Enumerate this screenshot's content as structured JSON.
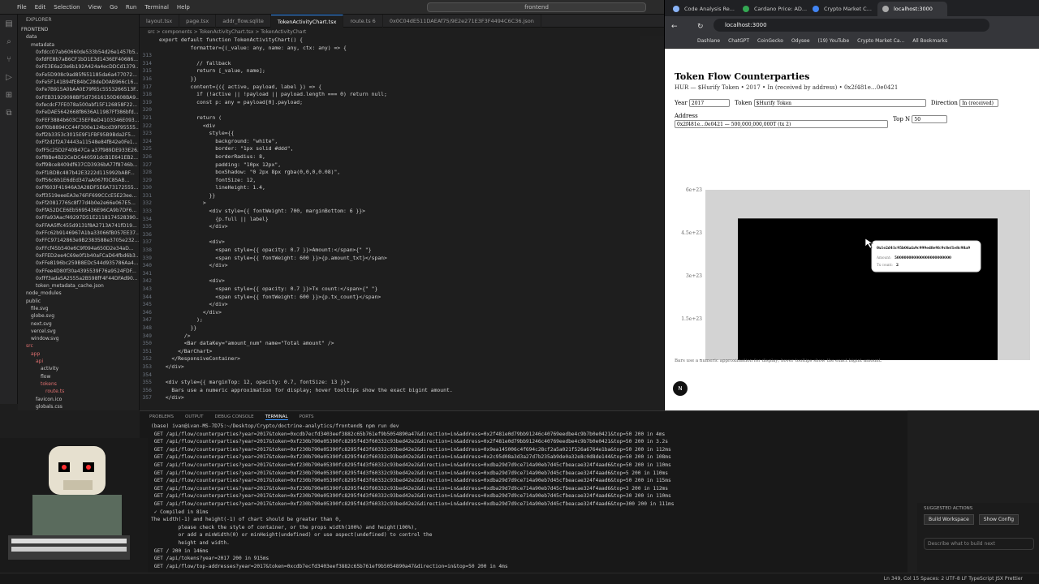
{
  "vscode": {
    "menu": [
      "File",
      "Edit",
      "Selection",
      "View",
      "Go",
      "Run",
      "Terminal",
      "Help"
    ],
    "search": "frontend",
    "explorer_title": "EXPLORER",
    "tree": [
      {
        "t": "FRONTEND",
        "i": 0
      },
      {
        "t": "data",
        "i": 1
      },
      {
        "t": "metadata",
        "i": 2
      },
      {
        "t": "0xfdcc07ab60660de533b54d26e1457b5...",
        "i": 3
      },
      {
        "t": "0xfdFE8b7aB6CF1bD1E3d1436EF40686...",
        "i": 3
      },
      {
        "t": "0xFE3E6a23e6b192A424a4ecDDCd1379...",
        "i": 3
      },
      {
        "t": "0xFe5D908c9ad85f651185da6a477072...",
        "i": 3
      },
      {
        "t": "0xFe5F141B94fE84bC28deD0AB966c16...",
        "i": 3
      },
      {
        "t": "0xFe7B915A0bAA0E79f65c5553266513F...",
        "i": 3
      },
      {
        "t": "0xFEB31929098BF5d73616150D608BA9...",
        "i": 3
      },
      {
        "t": "0xfecdcF7FE078a500abf15F126858F22...",
        "i": 3
      },
      {
        "t": "0xFeDAE5642668f8636A11987Ff386bfd...",
        "i": 3
      },
      {
        "t": "0xFEF3884b603C35EF8eD4103346E093...",
        "i": 3
      },
      {
        "t": "0xFf0b8894CC44F300e124bcd39F95555...",
        "i": 3
      },
      {
        "t": "0xff2b3353c3015E9F1FBF95B9Bda2F5...",
        "i": 3
      },
      {
        "t": "0xFf2d2f2A74443a11548e84fB42e0Fe1...",
        "i": 3
      },
      {
        "t": "0xfF5c25D2F40B47Ca a37f989DE933E26...",
        "i": 3
      },
      {
        "t": "0xff8Be4B22CeDC440591dcB1E641EB2...",
        "i": 3
      },
      {
        "t": "0xff9Bce8409df637CD3936bA77f8746b...",
        "i": 3
      },
      {
        "t": "0xFf1BDBc487b42E3222d115992bABF...",
        "i": 3
      },
      {
        "t": "0xff56c6b1E6dEd347aA067f0C85AB...",
        "i": 3
      },
      {
        "t": "0xFf603F41946A3A28DF5E6A73172555...",
        "i": 3
      },
      {
        "t": "0xff3519eeeEA3e76FiF699CCcE5E23ee...",
        "i": 3
      },
      {
        "t": "0xFf2081776Sc8f77d4b0e2e66e067E5...",
        "i": 3
      },
      {
        "t": "0xFfA52DCE6Eb5695436E96CA9b7DF6...",
        "i": 3
      },
      {
        "t": "0xFFa93Aacf49297D51E2118174528390...",
        "i": 3
      },
      {
        "t": "0xFFAA5ffc455d9131f8A2713A741fD19...",
        "i": 3
      },
      {
        "t": "0xFFc62b9146967A1ba33066fB057EE37...",
        "i": 3
      },
      {
        "t": "0xFFC97142863e9B2383588e3705e232...",
        "i": 3
      },
      {
        "t": "0xFFcf45b540e6C9f094a650D2e34aD...",
        "i": 3
      },
      {
        "t": "0xFFED2ee4C69e0f1b40aFCaD64fbd6b3...",
        "i": 3
      },
      {
        "t": "0xFFe8196bc259B8EDc544d935786Aa4...",
        "i": 3
      },
      {
        "t": "0xFFee4D80f30a4395539F76a9524FDF...",
        "i": 3
      },
      {
        "t": "0xfFf3adaSA2555a2B598fF4F44DFAd90...",
        "i": 3
      },
      {
        "t": "token_metadata_cache.json",
        "i": 3
      },
      {
        "t": "node_modules",
        "i": 1
      },
      {
        "t": "public",
        "i": 1
      },
      {
        "t": "file.svg",
        "i": 2
      },
      {
        "t": "globe.svg",
        "i": 2
      },
      {
        "t": "next.svg",
        "i": 2
      },
      {
        "t": "vercel.svg",
        "i": 2
      },
      {
        "t": "window.svg",
        "i": 2
      },
      {
        "t": "src",
        "i": 1,
        "c": "red"
      },
      {
        "t": "app",
        "i": 2,
        "c": "red"
      },
      {
        "t": "api",
        "i": 3,
        "c": "red"
      },
      {
        "t": "activity",
        "i": 4
      },
      {
        "t": "flow",
        "i": 4
      },
      {
        "t": "tokens",
        "i": 4,
        "c": "red"
      },
      {
        "t": "route.ts",
        "i": 5,
        "c": "red"
      },
      {
        "t": "favicon.ico",
        "i": 3
      },
      {
        "t": "globals.css",
        "i": 3
      },
      {
        "t": "layout.tsx",
        "i": 3
      },
      {
        "t": "page.tsx",
        "i": 3
      },
      {
        "t": "components",
        "i": 2
      }
    ],
    "tabs": [
      "layout.tsx",
      "page.tsx",
      "addr_flow.sqlite",
      "TokenActivityChart.tsx",
      "route.ts 6",
      "0x0C04dE511DAEAf75/9E2e271E3F3F4494C6C36.json"
    ],
    "active_tab": 3,
    "breadcrumb": "src > components > TokenActivityChart.tsx > TokenActivityChart",
    "code": [
      {
        "n": "",
        "c": "export default function TokenActivityChart() {"
      },
      {
        "n": "",
        "c": "          formatter={(_value: any, name: any, ctx: any) => {"
      },
      {
        "n": "313",
        "c": ""
      },
      {
        "n": "314",
        "c": "            // fallback"
      },
      {
        "n": "315",
        "c": "            return [_value, name];"
      },
      {
        "n": "316",
        "c": "          }}"
      },
      {
        "n": "317",
        "c": "          content={({ active, payload, label }) => {"
      },
      {
        "n": "318",
        "c": "            if (!active || !payload || payload.length === 0) return null;"
      },
      {
        "n": "319",
        "c": "            const p: any = payload[0].payload;"
      },
      {
        "n": "320",
        "c": ""
      },
      {
        "n": "321",
        "c": "            return ("
      },
      {
        "n": "322",
        "c": "              <div"
      },
      {
        "n": "323",
        "c": "                style={{"
      },
      {
        "n": "324",
        "c": "                  background: \"white\","
      },
      {
        "n": "325",
        "c": "                  border: \"1px solid #ddd\","
      },
      {
        "n": "326",
        "c": "                  borderRadius: 8,"
      },
      {
        "n": "327",
        "c": "                  padding: \"10px 12px\","
      },
      {
        "n": "328",
        "c": "                  boxShadow: \"0 2px 8px rgba(0,0,0,0.08)\","
      },
      {
        "n": "329",
        "c": "                  fontSize: 12,"
      },
      {
        "n": "330",
        "c": "                  lineHeight: 1.4,"
      },
      {
        "n": "331",
        "c": "                }}"
      },
      {
        "n": "332",
        "c": "              >"
      },
      {
        "n": "333",
        "c": "                <div style={{ fontWeight: 700, marginBottom: 6 }}>"
      },
      {
        "n": "334",
        "c": "                  {p.full || label}"
      },
      {
        "n": "335",
        "c": "                </div>"
      },
      {
        "n": "336",
        "c": ""
      },
      {
        "n": "337",
        "c": "                <div>"
      },
      {
        "n": "338",
        "c": "                  <span style={{ opacity: 0.7 }}>Amount:</span>{\" \"}"
      },
      {
        "n": "339",
        "c": "                  <span style={{ fontWeight: 600 }}>{p.amount_txt}</span>"
      },
      {
        "n": "340",
        "c": "                </div>"
      },
      {
        "n": "341",
        "c": ""
      },
      {
        "n": "342",
        "c": "                <div>"
      },
      {
        "n": "343",
        "c": "                  <span style={{ opacity: 0.7 }}>Tx count:</span>{\" \"}"
      },
      {
        "n": "344",
        "c": "                  <span style={{ fontWeight: 600 }}>{p.tx_count}</span>"
      },
      {
        "n": "345",
        "c": "                </div>"
      },
      {
        "n": "346",
        "c": "              </div>"
      },
      {
        "n": "347",
        "c": "            );"
      },
      {
        "n": "348",
        "c": "          }}"
      },
      {
        "n": "349",
        "c": "        />"
      },
      {
        "n": "350",
        "c": "        <Bar dataKey=\"amount_num\" name=\"Total amount\" />"
      },
      {
        "n": "351",
        "c": "      </BarChart>"
      },
      {
        "n": "352",
        "c": "    </ResponsiveContainer>"
      },
      {
        "n": "353",
        "c": "  </div>"
      },
      {
        "n": "354",
        "c": ""
      },
      {
        "n": "355",
        "c": "  <div style={{ marginTop: 12, opacity: 0.7, fontSize: 13 }}>"
      },
      {
        "n": "356",
        "c": "    Bars use a numeric approximation for display; hover tooltips show the exact bigint amount."
      },
      {
        "n": "357",
        "c": "  </div>"
      }
    ],
    "panel_tabs": [
      "PROBLEMS",
      "OUTPUT",
      "DEBUG CONSOLE",
      "TERMINAL",
      "PORTS"
    ],
    "terminal": [
      "(base) ivan@ivan-MS-7D75:~/Desktop/Crypto/doctrine-analytics/frontend$ npm run dev",
      " GET /api/flow/counterparties?year=2017&token=0xcdb7ecfd3403eef3882c65b761ef9b5054890a47&direction=in&address=0x2f481e0d79bb91246c40769eedbe4c9b7b0e0421&top=50 200 in 4ms",
      " GET /api/flow/counterparties?year=2017&token=0xf230b790e05390fc8295f4d3f60332c93bed42e2&direction=in&address=0x2f481e0d79bb91246c40769eedbe4c9b7b0e0421&top=50 200 in 3.2s",
      " GET /api/flow/counterparties?year=2017&token=0xf230b790e05390fc8295f4d3f60332c93bed42e2&direction=in&address=0x9ea145006c4f694c28cf2a5a021f526a6764e1ba&top=50 200 in 112ms",
      " GET /api/flow/counterparties?year=2017&token=0xf230b790e05390fc8295f4d3f60332c93bed42e2&direction=in&address=0x2c95d08a3d3a27d7b235ab9de0a32e8c0d8de144&top=50 200 in 108ms",
      " GET /api/flow/counterparties?year=2017&token=0xf230b790e05390fc8295f4d3f60332c93bed42e2&direction=in&address=0xdba29d7d9ce714a90eb7d45cfbeacae324f4aad6&top=50 200 in 110ms",
      " GET /api/flow/counterparties?year=2017&token=0xf230b790e05390fc8295f4d3f60332c93bed42e2&direction=in&address=0xdba29d7d9ce714a90eb7d45cfbeacae324f4aad6&top=5 200 in 110ms",
      " GET /api/flow/counterparties?year=2017&token=0xf230b790e05390fc8295f4d3f60332c93bed42e2&direction=in&address=0xdba29d7d9ce714a90eb7d45cfbeacae324f4aad6&top=50 200 in 115ms",
      " GET /api/flow/counterparties?year=2017&token=0xf230b790e05390fc8295f4d3f60332c93bed42e2&direction=in&address=0xdba29d7d9ce714a90eb7d45cfbeacae324f4aad6&top=3 200 in 112ms",
      " GET /api/flow/counterparties?year=2017&token=0xf230b790e05390fc8295f4d3f60332c93bed42e2&direction=in&address=0xdba29d7d9ce714a90eb7d45cfbeacae324f4aad6&top=30 200 in 110ms",
      " GET /api/flow/counterparties?year=2017&token=0xf230b790e05390fc8295f4d3f60332c93bed42e2&direction=in&address=0xdba29d7d9ce714a90eb7d45cfbeacae324f4aad6&top=300 200 in 111ms",
      " ✓ Compiled in 81ms",
      "The width(-1) and height(-1) of chart should be greater than 0,",
      "         please check the style of container, or the props width(100%) and height(100%),",
      "         or add a minWidth(0) or minHeight(undefined) or use aspect(undefined) to control the",
      "         height and width.",
      " GET / 200 in 146ms",
      " GET /api/tokens?year=2017 200 in 915ms",
      " GET /api/flow/top-addresses?year=2017&token=0xcdb7ecfd3403eef3882c65b761ef9b5054890a47&direction=in&top=50 200 in 4ms"
    ],
    "suggestions_title": "SUGGESTED ACTIONS",
    "suggestions": [
      "Build Workspace",
      "Show Config"
    ],
    "chat_placeholder": "Describe what to build next",
    "status_right": "Ln 349, Col 15   Spaces: 2   UTF-8   LF   TypeScript JSX   Prettier"
  },
  "browser": {
    "tabs": [
      {
        "label": "Code Analysis Re...",
        "color": "#8ab4f8"
      },
      {
        "label": "Cardano Price: AD...",
        "color": "#34a853"
      },
      {
        "label": "Crypto Market C...",
        "color": "#4285f4"
      },
      {
        "label": "localhost:3000",
        "color": "#aaaaaa"
      }
    ],
    "active_tab": 3,
    "url": "localhost:3000",
    "bookmarks": [
      "Dashlane",
      "ChatGPT",
      "CoinGecko",
      "Odysee",
      "(19) YouTube",
      "Crypto Market Ca...",
      "All Bookmarks"
    ]
  },
  "app": {
    "title": "Token Flow Counterparties",
    "subtitle": "HUR — $Hurify Token • 2017 • In (received by address) • 0x2f481e…0e0421",
    "year_label": "Year",
    "year_value": "2017",
    "token_label": "Token",
    "token_value": "$Hurify Token",
    "direction_label": "Direction",
    "direction_value": "In (received)",
    "address_label": "Address",
    "address_value": "0x2f481e…0e0421 — 500,000,000,000T (tx 2)",
    "topn_label": "Top N",
    "topn_value": "50",
    "note": "Bars use a numeric approximation for display; hover tooltips show the exact bigint amount.",
    "n_badge": "N"
  },
  "chart_data": {
    "type": "bar",
    "categories": [
      "0x1e2d41…8c98a9"
    ],
    "values": [
      5e+23
    ],
    "ylim": [
      0,
      6e+23
    ],
    "yticks": [
      "0",
      "1.5e+23",
      "3e+23",
      "4.5e+23",
      "6e+23"
    ],
    "colors": {
      "bar": "#000000",
      "plot_bg": "#d3d3d3"
    },
    "tooltip": {
      "title": "0x1e2d41c95b06afa9c999ed8e9fc9c8ef1e8c98a9",
      "amount_label": "Amount:",
      "amount": "500000000000000000000000",
      "tx_label": "Tx count:",
      "tx": "2"
    }
  }
}
